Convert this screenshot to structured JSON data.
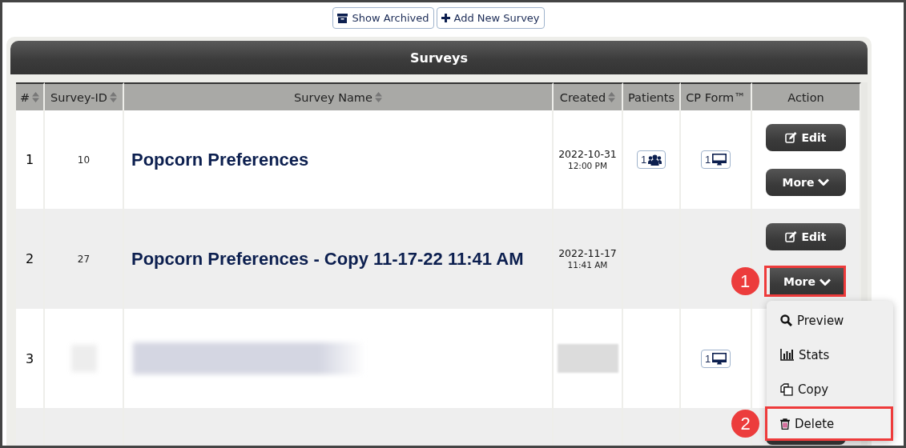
{
  "toolbar": [
    {
      "kind": "archive",
      "label": "Show Archived"
    },
    {
      "kind": "add",
      "label": "Add New Survey"
    }
  ],
  "panel": {
    "title": "Surveys"
  },
  "table": {
    "columns": [
      {
        "label": "#",
        "sortable": true
      },
      {
        "label": "Survey-ID",
        "sortable": true
      },
      {
        "label": "Survey Name",
        "sortable": true
      },
      {
        "label": "Created",
        "sortable": true
      },
      {
        "label": "Patients",
        "sortable": false
      },
      {
        "label": "CP Form™",
        "sortable": false
      },
      {
        "label": "Action",
        "sortable": false
      }
    ],
    "rows": [
      {
        "number": "1",
        "survey_id": "10",
        "name": "Popcorn Preferences",
        "created_date": "2022-10-31",
        "created_time": "12:00 PM",
        "patients": "1",
        "cp_form": "1",
        "actions": [
          {
            "kind": "edit",
            "label": "Edit",
            "highlighted": false
          },
          {
            "kind": "more",
            "label": "More",
            "highlighted": false
          }
        ]
      },
      {
        "number": "2",
        "survey_id": "27",
        "name": "Popcorn Preferences - Copy 11-17-22 11:41 AM",
        "created_date": "2022-11-17",
        "created_time": "11:41 AM",
        "actions": [
          {
            "kind": "edit",
            "label": "Edit",
            "highlighted": false
          },
          {
            "kind": "more",
            "label": "More",
            "highlighted": true,
            "callout": "1"
          }
        ]
      },
      {
        "number": "3",
        "redacted": true,
        "cp_form": "1"
      },
      {
        "actions": [
          {
            "kind": "edit",
            "covered": true
          }
        ]
      }
    ]
  },
  "menu": {
    "items": [
      {
        "kind": "preview",
        "label": "Preview",
        "highlighted": false
      },
      {
        "kind": "stats",
        "label": "Stats",
        "highlighted": false
      },
      {
        "kind": "copy",
        "label": "Copy",
        "highlighted": false
      },
      {
        "kind": "delete",
        "label": "Delete",
        "highlighted": true,
        "callout": "2"
      }
    ]
  }
}
